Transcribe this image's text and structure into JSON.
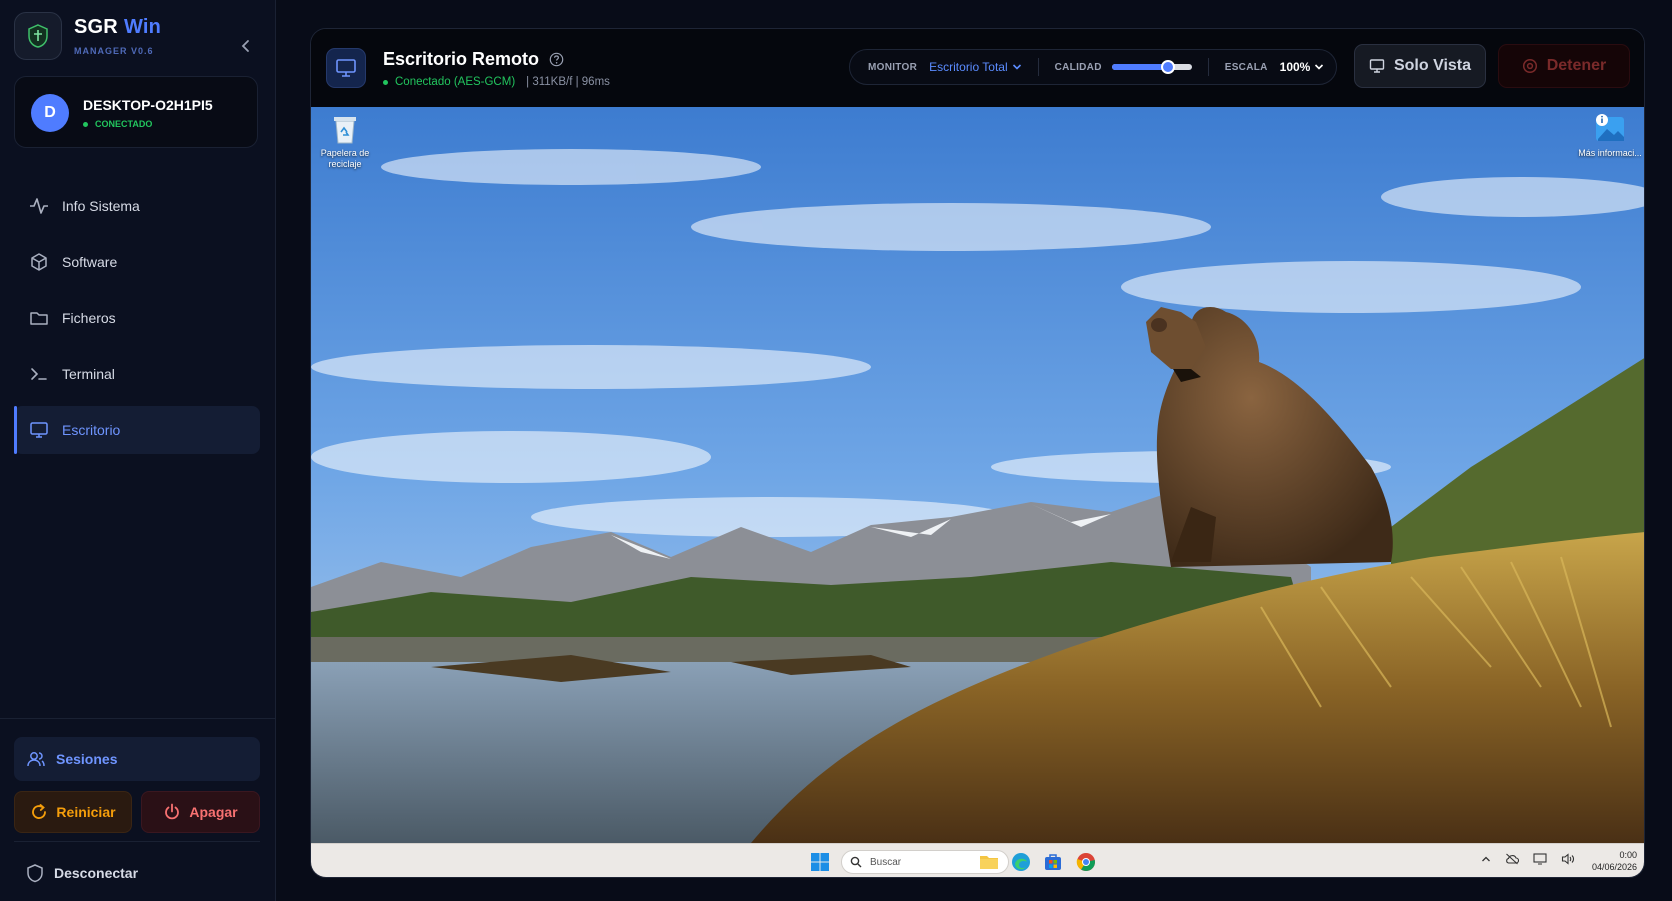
{
  "brand": {
    "name": "SGR",
    "name_accent": "Win",
    "version": "MANAGER V0.6"
  },
  "device": {
    "initial": "D",
    "name": "DESKTOP-O2H1PI5",
    "status": "CONECTADO"
  },
  "nav": [
    {
      "label": "Info Sistema",
      "icon": "activity-icon"
    },
    {
      "label": "Software",
      "icon": "package-icon"
    },
    {
      "label": "Ficheros",
      "icon": "folder-icon"
    },
    {
      "label": "Terminal",
      "icon": "terminal-icon"
    },
    {
      "label": "Escritorio",
      "icon": "monitor-icon",
      "active": true
    }
  ],
  "bottom": {
    "sessions": "Sesiones",
    "reboot": "Reiniciar",
    "shutdown": "Apagar",
    "disconnect": "Desconectar"
  },
  "header": {
    "title": "Escritorio Remoto",
    "status": "Conectado (AES-GCM)",
    "stats": "| 311KB/f | 96ms"
  },
  "controls": {
    "monitor_label": "MONITOR",
    "monitor_value": "Escritorio Total",
    "quality_label": "CALIDAD",
    "quality_level": 0.7,
    "scale_label": "ESCALA",
    "scale_value": "100%"
  },
  "actions": {
    "view_only": "Solo Vista",
    "stop": "Detener"
  },
  "remote": {
    "icons": [
      {
        "label": "Papelera de reciclaje"
      },
      {
        "label": "Más informaci..."
      }
    ],
    "taskbar": {
      "search_placeholder": "Buscar",
      "time": "0:00",
      "date": "04/06/2026"
    }
  },
  "colors": {
    "accent": "#4f7cff",
    "success": "#22c55e",
    "warning": "#f59e0b",
    "danger": "#f87171",
    "background": "#080c18"
  }
}
